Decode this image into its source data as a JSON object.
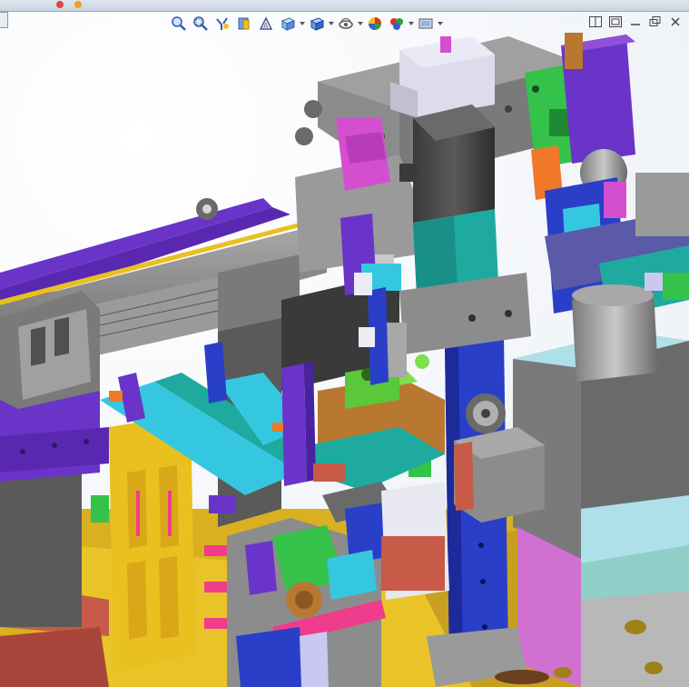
{
  "window": {
    "title_controls": [
      "close",
      "minimize"
    ],
    "colors": {
      "close": "#e0453a",
      "minimize": "#f0a020",
      "frame": "#c9d3e0"
    }
  },
  "heads_up_toolbar": {
    "buttons": [
      {
        "icon": "zoom-to-fit-icon"
      },
      {
        "icon": "zoom-to-area-icon"
      },
      {
        "icon": "previous-view-icon"
      },
      {
        "icon": "section-view-icon"
      },
      {
        "icon": "dynamic-annotation-icon"
      },
      {
        "icon": "view-orientation-icon",
        "dropdown": true
      },
      {
        "icon": "display-style-icon",
        "dropdown": true
      },
      {
        "icon": "hide-show-items-icon",
        "dropdown": true
      },
      {
        "icon": "edit-appearance-icon"
      },
      {
        "icon": "apply-scene-icon",
        "dropdown": true
      },
      {
        "icon": "view-settings-icon",
        "dropdown": true
      }
    ]
  },
  "viewport_controls": {
    "buttons": [
      {
        "icon": "split-viewport-icon"
      },
      {
        "icon": "link-views-icon"
      },
      {
        "icon": "minimize-window-icon"
      },
      {
        "icon": "restore-window-icon"
      },
      {
        "icon": "close-window-icon"
      }
    ]
  },
  "model": {
    "palette": {
      "grey": "#8c8c8c",
      "dark_grey": "#505050",
      "purple": "#6a34c8",
      "violet": "#8f4fd8",
      "magenta": "#d44fd0",
      "pink": "#f03c8c",
      "blue": "#2a3fc8",
      "navy": "#1d2a9a",
      "yellow": "#e8c020",
      "gold": "#d8a818",
      "teal": "#1faaa0",
      "cyan": "#36c7e0",
      "light_cyan": "#aee0ea",
      "green": "#34c24a",
      "lime": "#7ee04a",
      "orange": "#f07828",
      "brown": "#b87830",
      "salmon": "#c86050",
      "lavender": "#c8c8f0",
      "white": "#ececf4"
    }
  }
}
